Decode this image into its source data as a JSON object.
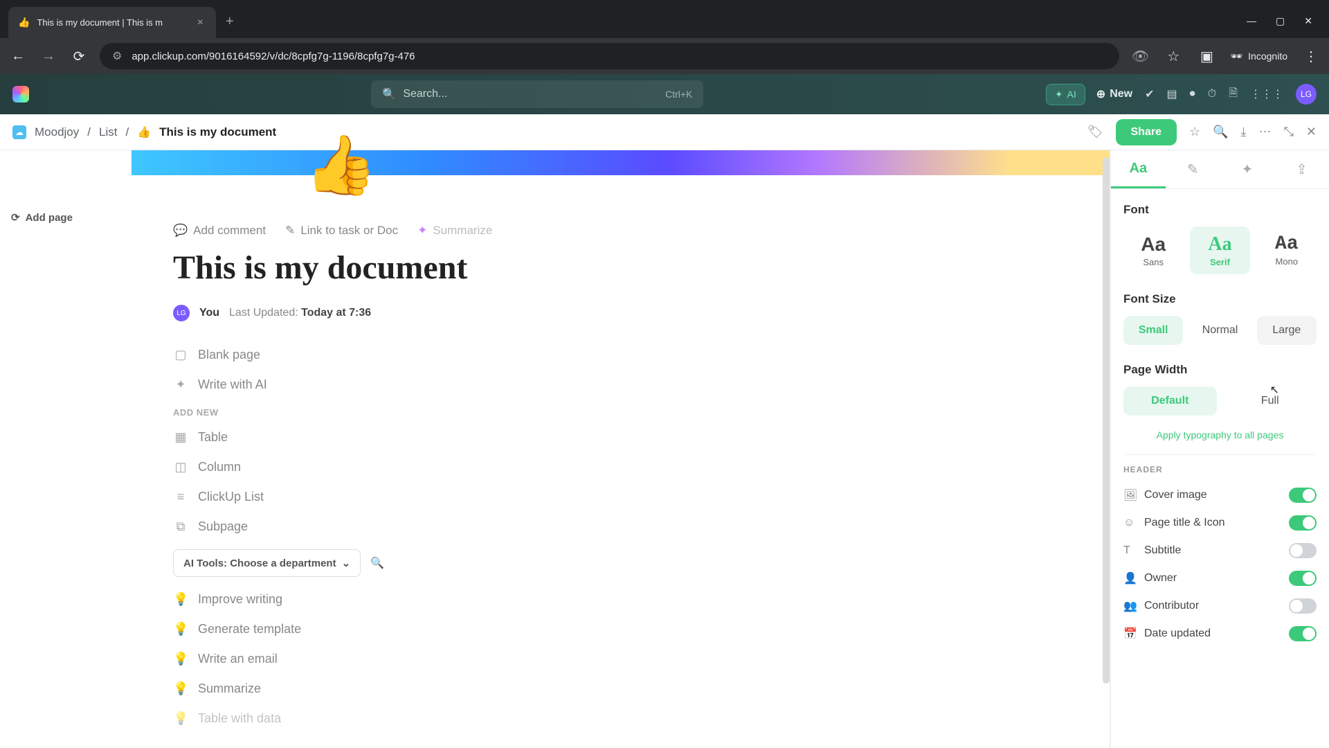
{
  "browser": {
    "tab_title": "This is my document | This is m",
    "tab_emoji": "👍",
    "url": "app.clickup.com/9016164592/v/dc/8cpfg7g-1196/8cpfg7g-476",
    "incognito": "Incognito"
  },
  "app_header": {
    "search_placeholder": "Search...",
    "search_kbd": "Ctrl+K",
    "ai_label": "AI",
    "new_label": "New",
    "avatar_initials": "LG"
  },
  "breadcrumb": {
    "seg1": "Moodjoy",
    "seg2": "List",
    "seg3": "This is my document",
    "seg3_emoji": "👍",
    "share": "Share"
  },
  "left": {
    "add_page": "Add page"
  },
  "doc": {
    "emoji": "👍",
    "actions": {
      "comment": "Add comment",
      "link": "Link to task or Doc",
      "summarize": "Summarize"
    },
    "title": "This is my document",
    "meta": {
      "av": "LG",
      "you": "You",
      "updated_label": "Last Updated:",
      "updated_value": "Today at 7:36"
    },
    "options": {
      "blank": "Blank page",
      "ai": "Write with AI",
      "add_new": "ADD NEW",
      "table": "Table",
      "column": "Column",
      "list": "ClickUp List",
      "subpage": "Subpage"
    },
    "ai_tools": {
      "label": "AI Tools: Choose a department",
      "improve": "Improve writing",
      "template": "Generate template",
      "email": "Write an email",
      "summarize": "Summarize",
      "table_data": "Table with data"
    }
  },
  "panel": {
    "tabs": {
      "aa": "Aa"
    },
    "font": {
      "h": "Font",
      "sans": "Sans",
      "serif": "Serif",
      "mono": "Mono",
      "sample": "Aa"
    },
    "font_size": {
      "h": "Font Size",
      "small": "Small",
      "normal": "Normal",
      "large": "Large"
    },
    "page_width": {
      "h": "Page Width",
      "default": "Default",
      "full": "Full"
    },
    "apply": "Apply typography to all pages",
    "header_h": "HEADER",
    "toggles": {
      "cover": "Cover image",
      "title": "Page title & Icon",
      "subtitle": "Subtitle",
      "owner": "Owner",
      "contributor": "Contributor",
      "date": "Date updated"
    }
  }
}
